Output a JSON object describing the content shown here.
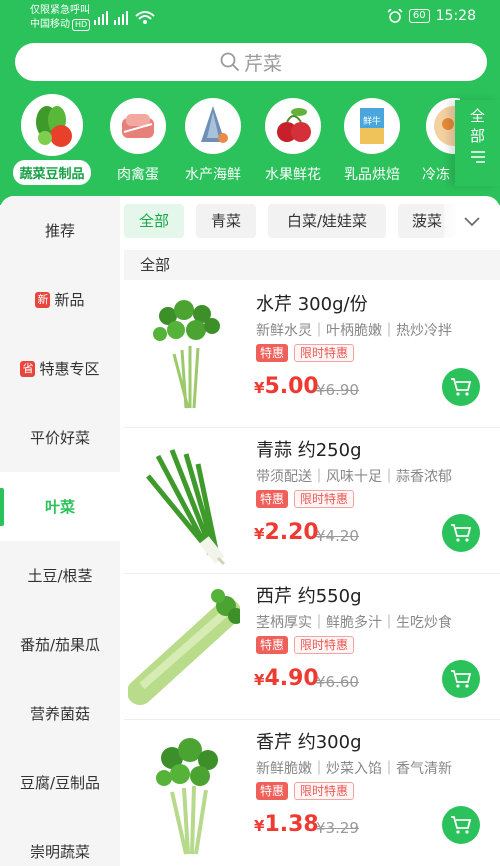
{
  "status_bar": {
    "emergency": "仅限紧急呼叫",
    "carrier": "中国移动",
    "hd": "HD",
    "battery": "60",
    "time": "15:28"
  },
  "search": {
    "placeholder": "芹菜"
  },
  "categories": [
    {
      "label": "蔬菜豆制品",
      "active": true
    },
    {
      "label": "肉禽蛋"
    },
    {
      "label": "水产海鲜"
    },
    {
      "label": "水果鲜花"
    },
    {
      "label": "乳品烘焙",
      "image_text": "鲜牛"
    },
    {
      "label": "冷冻"
    }
  ],
  "all_categories_label": "全部",
  "sidebar": [
    {
      "label": "推荐"
    },
    {
      "tag": "新",
      "label": "新品"
    },
    {
      "tag": "省",
      "label": "特惠专区"
    },
    {
      "label": "平价好菜"
    },
    {
      "label": "叶菜",
      "active": true
    },
    {
      "label": "土豆/根茎"
    },
    {
      "label": "番茄/茄果瓜"
    },
    {
      "label": "营养菌菇"
    },
    {
      "label": "豆腐/豆制品"
    },
    {
      "label": "崇明蔬菜"
    }
  ],
  "filters": [
    {
      "label": "全部",
      "active": true
    },
    {
      "label": "青菜"
    },
    {
      "label": "白菜/娃娃菜"
    },
    {
      "label": "菠菜"
    }
  ],
  "section_title": "全部",
  "products": [
    {
      "name": "水芹 300g/份",
      "desc": "新鲜水灵｜叶柄脆嫩｜热炒冷拌",
      "tag1": "特惠",
      "tag2": "限时特惠",
      "currency": "¥",
      "price": "5.00",
      "old_price": "¥6.90",
      "image": "water-celery"
    },
    {
      "name": "青蒜 约250g",
      "desc": "带须配送｜风味十足｜蒜香浓郁",
      "tag1": "特惠",
      "tag2": "限时特惠",
      "currency": "¥",
      "price": "2.20",
      "old_price": "¥4.20",
      "image": "green-garlic"
    },
    {
      "name": "西芹 约550g",
      "desc": "茎柄厚实｜鲜脆多汁｜生吃炒食",
      "tag1": "特惠",
      "tag2": "限时特惠",
      "currency": "¥",
      "price": "4.90",
      "old_price": "¥6.60",
      "image": "celery"
    },
    {
      "name": "香芹 约300g",
      "desc": "新鲜脆嫩｜炒菜入馅｜香气清新",
      "tag1": "特惠",
      "tag2": "限时特惠",
      "currency": "¥",
      "price": "1.38",
      "old_price": "¥3.29",
      "image": "chinese-celery"
    }
  ],
  "colors": {
    "brand_green": "#2bc25b",
    "price_red": "#ee3a30"
  }
}
